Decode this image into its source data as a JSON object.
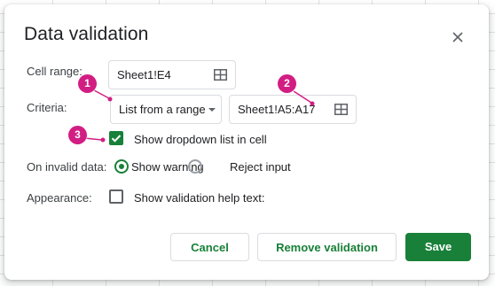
{
  "dialog": {
    "title": "Data validation"
  },
  "cell_range": {
    "label": "Cell range:",
    "value": "Sheet1!E4"
  },
  "criteria": {
    "label": "Criteria:",
    "type": "List from a range",
    "range": "Sheet1!A5:A17",
    "show_dropdown_label": "Show dropdown list in cell",
    "show_dropdown_checked": true
  },
  "invalid_data": {
    "label": "On invalid data:",
    "options": [
      "Show warning",
      "Reject input"
    ],
    "selected": "Show warning"
  },
  "appearance": {
    "label": "Appearance:",
    "help_text_label": "Show validation help text:",
    "help_text_checked": false
  },
  "buttons": {
    "cancel": "Cancel",
    "remove": "Remove validation",
    "save": "Save"
  },
  "callouts": [
    "1",
    "2",
    "3"
  ],
  "colors": {
    "accent": "#188038",
    "callout": "#d21e83"
  },
  "icons": {
    "close": "close-icon",
    "range_select": "grid-icon",
    "dropdown": "caret-down-icon",
    "checkbox": "checkmark-icon"
  }
}
